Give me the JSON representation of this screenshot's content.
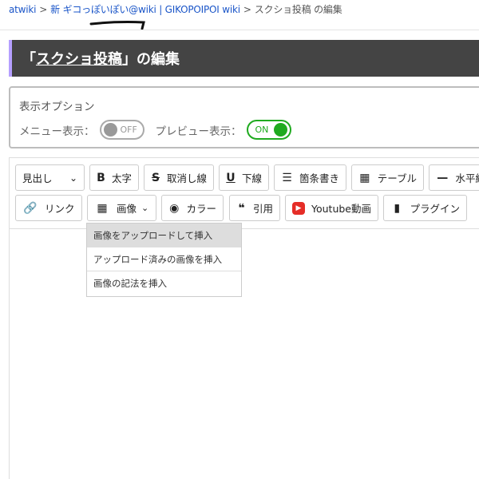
{
  "breadcrumb": {
    "root": "atwiki",
    "sep": ">",
    "wiki": "新 ギコっぽいぽい@wiki | GIKOPOIPOI wiki",
    "current": "スクショ投稿 の編集"
  },
  "title": {
    "open": "「",
    "page": "スクショ投稿",
    "close": "」の編集"
  },
  "options": {
    "heading": "表示オプション",
    "menu_label": "メニュー表示：",
    "menu_state": "OFF",
    "preview_label": "プレビュー表示：",
    "preview_state": "ON"
  },
  "toolbar": {
    "heading": "見出し",
    "bold": "太字",
    "strike": "取消し線",
    "underline": "下線",
    "list": "箇条書き",
    "table": "テーブル",
    "hr": "水平線",
    "link": "リンク",
    "image": "画像",
    "color": "カラー",
    "quote": "引用",
    "youtube": "Youtube動画",
    "plugin": "プラグイン"
  },
  "image_menu": [
    "画像をアップロードして挿入",
    "アップロード済みの画像を挿入",
    "画像の記法を挿入"
  ],
  "colors": {
    "link": "#1a55c8",
    "title_bg": "#444444",
    "accent": "#b59fff",
    "on": "#1faa1f",
    "youtube": "#e52d27"
  }
}
